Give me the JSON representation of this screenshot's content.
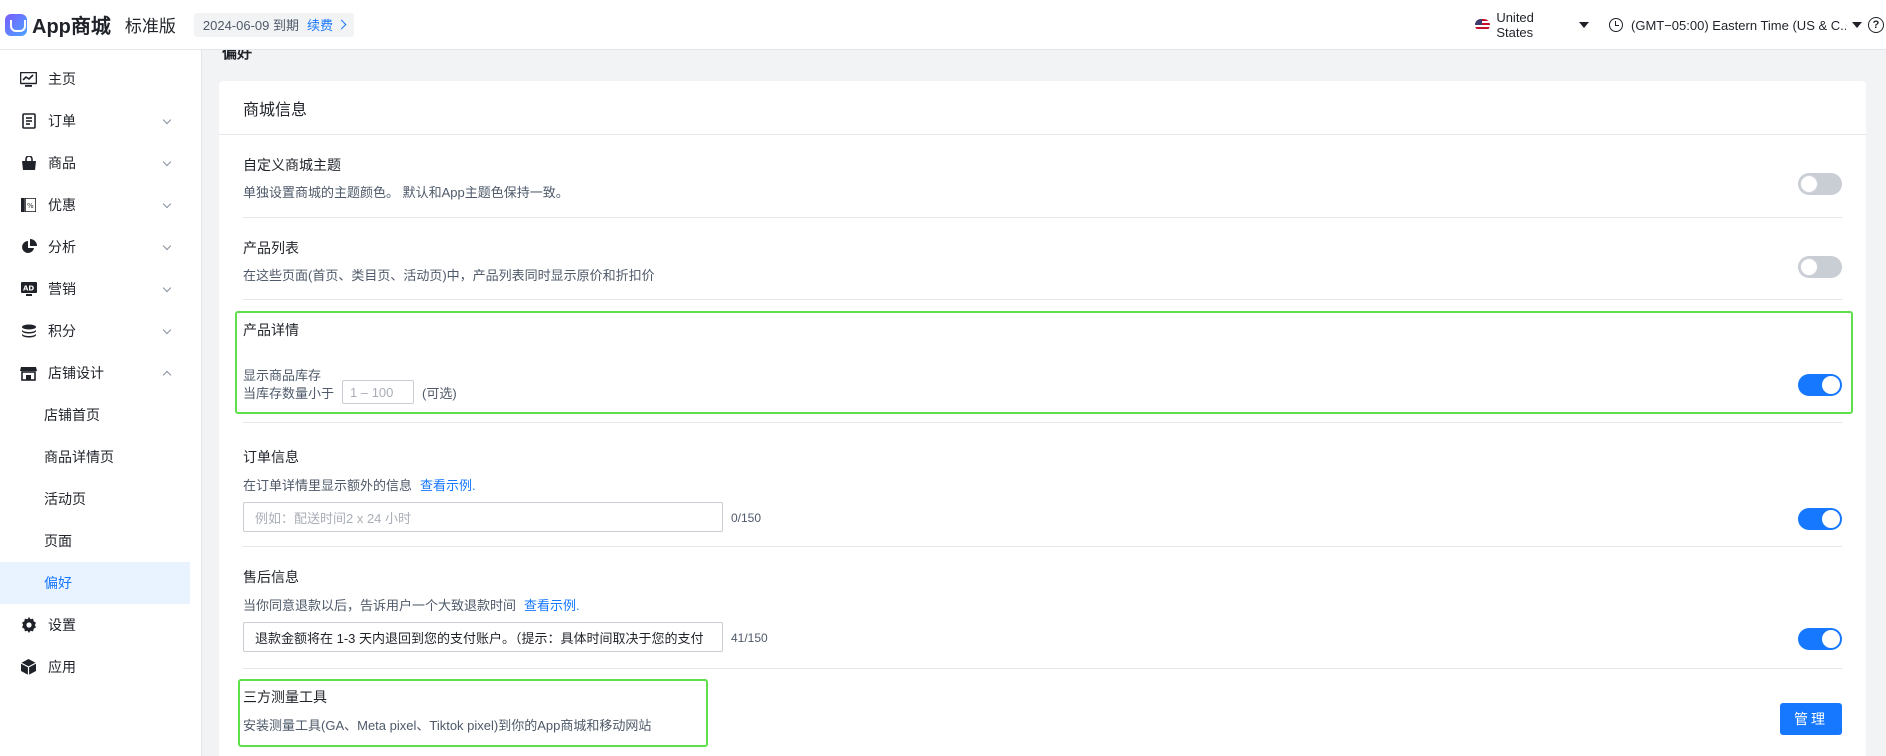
{
  "header": {
    "logo_text": "App商城",
    "edition": "标准版",
    "expiry_date": "2024-06-09 到期",
    "renew_label": "续费",
    "country": "United States",
    "timezone": "(GMT−05:00) Eastern Time (US & C..."
  },
  "sidebar": {
    "items": [
      {
        "label": "主页",
        "icon": "dashboard-icon"
      },
      {
        "label": "订单",
        "icon": "order-icon"
      },
      {
        "label": "商品",
        "icon": "shopping-bag-icon"
      },
      {
        "label": "优惠",
        "icon": "discount-icon"
      },
      {
        "label": "分析",
        "icon": "pie-chart-icon"
      },
      {
        "label": "营销",
        "icon": "ad-icon"
      },
      {
        "label": "积分",
        "icon": "coins-icon"
      },
      {
        "label": "店铺设计",
        "icon": "store-icon"
      }
    ],
    "sub_items": [
      "店铺首页",
      "商品详情页",
      "活动页",
      "页面",
      "偏好"
    ],
    "bottom_items": [
      {
        "label": "设置",
        "icon": "gear-icon"
      },
      {
        "label": "应用",
        "icon": "apps-cube-icon"
      }
    ]
  },
  "main": {
    "clipped_title": "偏好",
    "card_title": "商城信息",
    "sections": {
      "theme": {
        "title": "自定义商城主题",
        "desc": "单独设置商城的主题颜色。 默认和App主题色保持一致。",
        "enabled": false
      },
      "product_list": {
        "title": "产品列表",
        "desc": "在这些页面(首页、类目页、活动页)中，产品列表同时显示原价和折扣价",
        "enabled": false
      },
      "product_detail": {
        "title": "产品详情",
        "stock_label": "显示商品库存",
        "stock_prefix": "当库存数量小于",
        "stock_placeholder": "1 – 100",
        "optional": "(可选)",
        "enabled": true
      },
      "order_info": {
        "title": "订单信息",
        "desc": "在订单详情里显示额外的信息",
        "link": "查看示例.",
        "placeholder": "例如：配送时间2 x 24 小时",
        "counter": "0/150",
        "enabled": true
      },
      "after_sales": {
        "title": "售后信息",
        "desc": "当你同意退款以后，告诉用户一个大致退款时间",
        "link": "查看示例.",
        "value": "退款金额将在 1-3 天内退回到您的支付账户。（提示：具体时间取决于您的支付",
        "counter": "41/150",
        "enabled": true
      },
      "tracking": {
        "title": "三方测量工具",
        "desc": "安装测量工具(GA、Meta pixel、Tiktok pixel)到你的App商城和移动网站",
        "button": "管理"
      }
    }
  },
  "colors": {
    "accent": "#1677ff",
    "highlight": "#5ee04a"
  }
}
